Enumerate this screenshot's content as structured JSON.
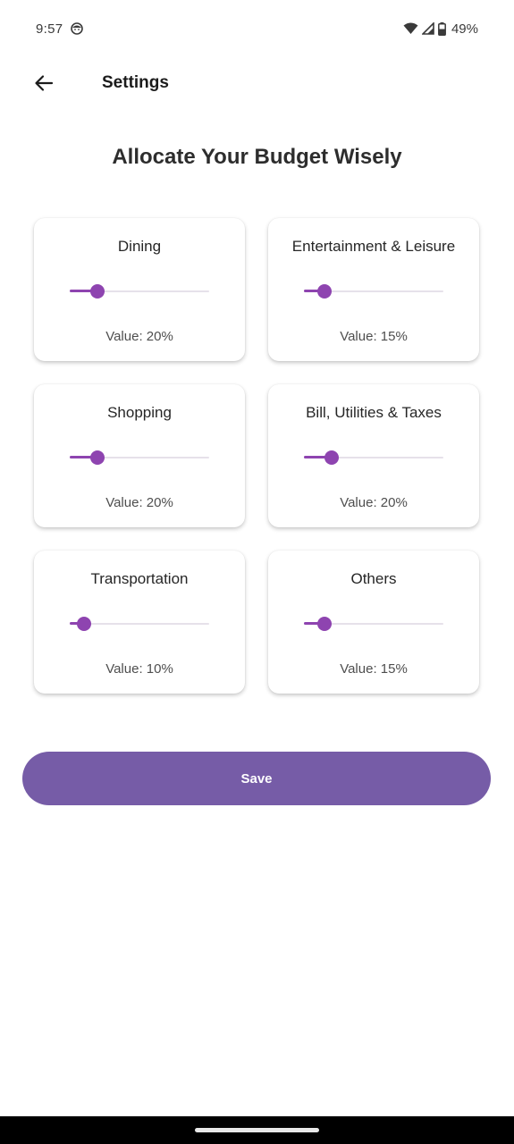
{
  "status_bar": {
    "time": "9:57",
    "battery": "49%"
  },
  "app_bar": {
    "title": "Settings"
  },
  "heading": "Allocate Your Budget Wisely",
  "accent_color": "#8e44b0",
  "button_color": "#765ca7",
  "categories": [
    {
      "name": "Dining",
      "value_label": "Value: 20%",
      "value": 20
    },
    {
      "name": "Entertainment & Leisure",
      "value_label": "Value: 15%",
      "value": 15
    },
    {
      "name": "Shopping",
      "value_label": "Value: 20%",
      "value": 20
    },
    {
      "name": "Bill, Utilities & Taxes",
      "value_label": "Value: 20%",
      "value": 20
    },
    {
      "name": "Transportation",
      "value_label": "Value: 10%",
      "value": 10
    },
    {
      "name": "Others",
      "value_label": "Value: 15%",
      "value": 15
    }
  ],
  "save_label": "Save"
}
